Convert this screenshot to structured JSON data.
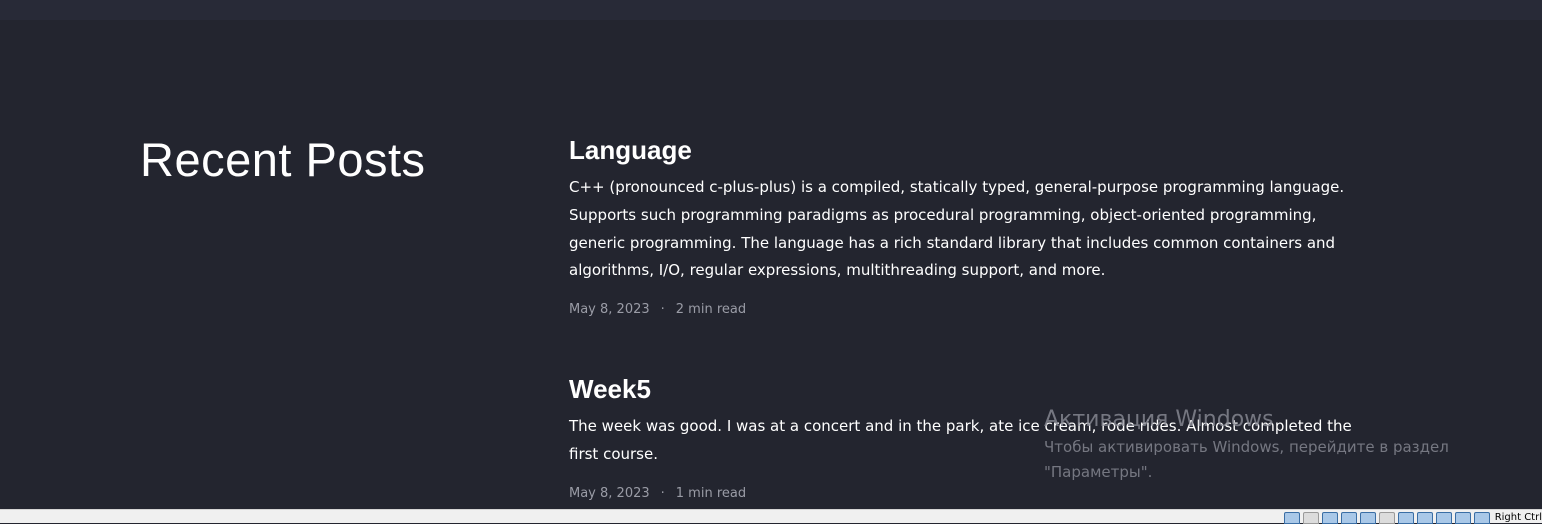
{
  "section": {
    "heading": "Recent Posts"
  },
  "posts": [
    {
      "title": "Language",
      "excerpt": "C++ (pronounced c-plus-plus) is a compiled, statically typed, general-purpose programming language. Supports such programming paradigms as procedural programming, object-oriented programming, generic programming. The language has a rich standard library that includes common containers and algorithms, I/O, regular expressions, multithreading support, and more.",
      "date": "May 8, 2023",
      "separator": "·",
      "read_time": "2 min read"
    },
    {
      "title": "Week5",
      "excerpt": "The week was good. I was at a concert and in the park, ate ice cream, rode rides. Almost completed the first course.",
      "date": "May 8, 2023",
      "separator": "·",
      "read_time": "1 min read"
    }
  ],
  "watermark": {
    "title": "Активация Windows",
    "line1": "Чтобы активировать Windows, перейдите в раздел",
    "line2": "\"Параметры\"."
  },
  "taskbar": {
    "host_key_label": "Right Ctrl",
    "tray_icons": [
      "hard-disk-icon",
      "optical-drive-icon",
      "audio-icon",
      "network-icon",
      "usb-icon",
      "shared-folder-icon",
      "display-icon",
      "recording-icon",
      "mouse-integration-icon",
      "virtualbox-icon",
      "download-icon"
    ]
  },
  "colors": {
    "background": "#23252f",
    "topbar": "#282a37",
    "text": "#ffffff",
    "meta_text": "#9a9ca6"
  }
}
